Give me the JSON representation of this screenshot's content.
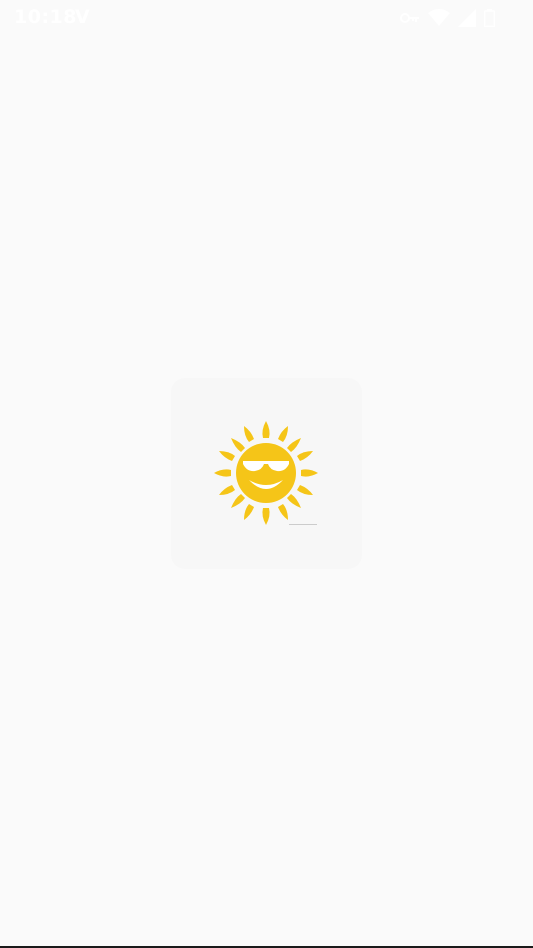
{
  "status_bar": {
    "time": "10:18",
    "carrier_icon": "V",
    "icons": [
      "vpn-key-icon",
      "wifi-icon",
      "signal-icon",
      "battery-icon"
    ]
  },
  "splash": {
    "logo_icon": "smiling-sun-sunglasses-icon"
  },
  "colors": {
    "background": "#fafafa",
    "card": "#f7f7f7",
    "sun": "#f5c518",
    "status_text": "#ffffff"
  }
}
